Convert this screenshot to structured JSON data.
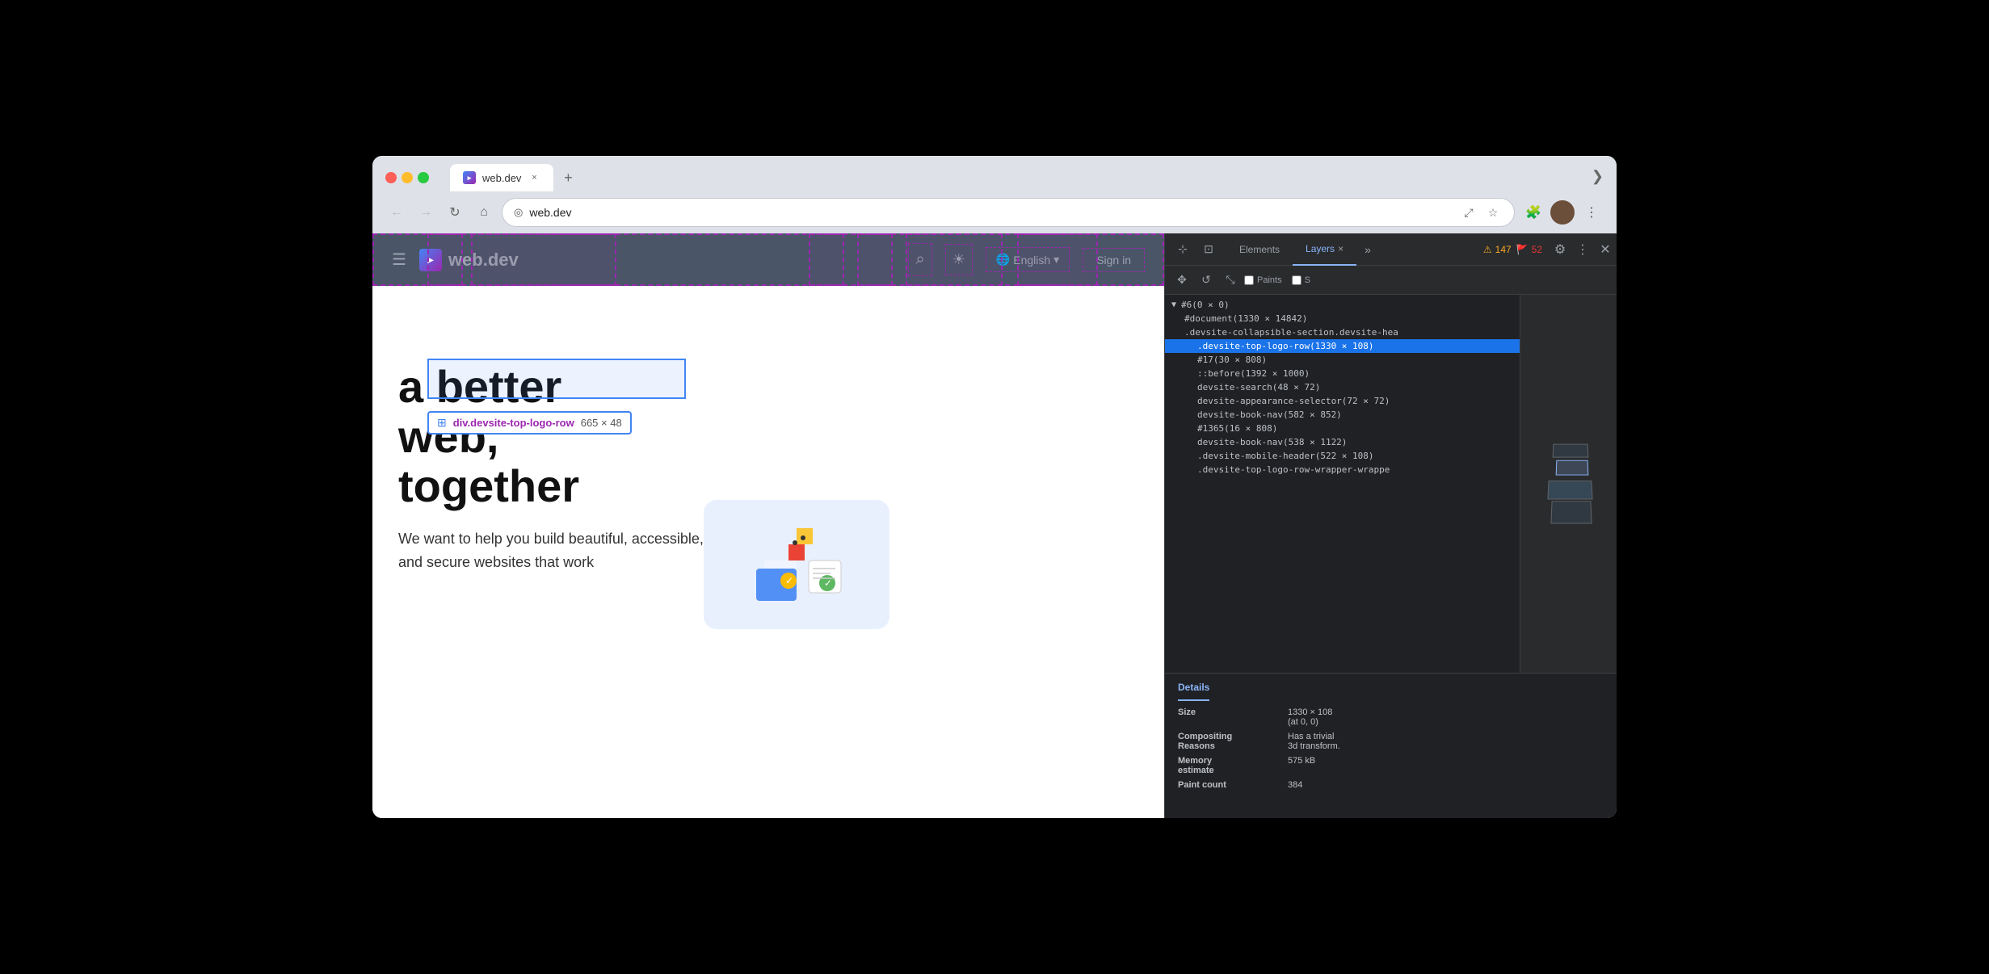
{
  "browser": {
    "tab": {
      "icon": "▸",
      "title": "web.dev",
      "close_label": "×"
    },
    "new_tab_label": "+",
    "overflow_label": "❯",
    "nav": {
      "back_label": "←",
      "forward_label": "→",
      "refresh_label": "↻",
      "home_label": "⌂"
    },
    "url": "web.dev",
    "url_icon": "◎",
    "actions": {
      "external": "⤢",
      "bookmark": "☆"
    },
    "toolbar": {
      "extension": "🧩",
      "more": "⋮"
    }
  },
  "webpage": {
    "header": {
      "menu_icon": "☰",
      "logo_icon": "▸",
      "logo_text": "web.dev",
      "search_icon": "⌕",
      "theme_icon": "☀",
      "lang": "English",
      "lang_arrow": "▾",
      "signin": "Sign in"
    },
    "element_label": {
      "name": "div.devsite-top-logo-row",
      "size": "665 × 48"
    },
    "hero": {
      "title_line1": "a better",
      "title_line2": "web,",
      "title_line3": "together",
      "subtitle": "We want to help you build beautiful, accessible, fast, and secure websites that work"
    }
  },
  "devtools": {
    "tabs": {
      "elements": "Elements",
      "layers": "Layers",
      "layers_close": "×",
      "more": "»"
    },
    "warnings": {
      "count": "147",
      "error_count": "52"
    },
    "toolbar": {
      "paints_label": "Paints",
      "s_label": "S"
    },
    "tree": {
      "root": "#6(0 × 0)",
      "items": [
        {
          "indent": 1,
          "text": "#document(1330 × 14842)",
          "selected": false
        },
        {
          "indent": 1,
          "text": ".devsite-collapsible-section.devsite-hea",
          "selected": false
        },
        {
          "indent": 2,
          "text": ".devsite-top-logo-row(1330 × 108)",
          "selected": true
        },
        {
          "indent": 2,
          "text": "#17(30 × 808)",
          "selected": false
        },
        {
          "indent": 2,
          "text": "::before(1392 × 1000)",
          "selected": false
        },
        {
          "indent": 2,
          "text": "devsite-search(48 × 72)",
          "selected": false
        },
        {
          "indent": 2,
          "text": "devsite-appearance-selector(72 × 72)",
          "selected": false
        },
        {
          "indent": 2,
          "text": "devsite-book-nav(582 × 852)",
          "selected": false
        },
        {
          "indent": 2,
          "text": "#1365(16 × 808)",
          "selected": false
        },
        {
          "indent": 2,
          "text": "devsite-book-nav(538 × 1122)",
          "selected": false
        },
        {
          "indent": 2,
          "text": ".devsite-mobile-header(522 × 108)",
          "selected": false
        },
        {
          "indent": 2,
          "text": ".devsite-top-logo-row-wrapper-wrappe",
          "selected": false
        }
      ]
    },
    "details": {
      "title": "Details",
      "rows": [
        {
          "label": "Size",
          "value": "1330 × 108\n(at 0, 0)"
        },
        {
          "label": "Compositing\nReasons",
          "value": "Has a trivial\n3d transform."
        },
        {
          "label": "Memory\nestimate",
          "value": "575 kB"
        },
        {
          "label": "Paint count",
          "value": "384"
        }
      ]
    }
  }
}
